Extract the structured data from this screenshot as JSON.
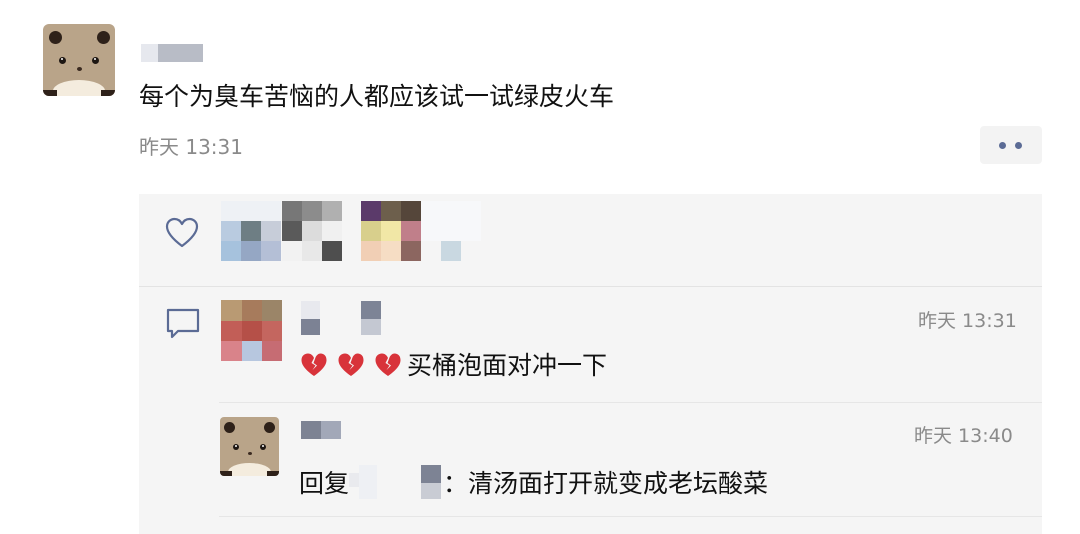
{
  "post": {
    "text": "每个为臭车苦恼的人都应该试一试绿皮火车",
    "time": "昨天 13:31",
    "author_avatar_icon": "bear-avatar-icon",
    "more_icon": "more-dots-icon"
  },
  "likes": {
    "icon": "heart-icon"
  },
  "comments": [
    {
      "icon": "comment-icon",
      "emoji": [
        "broken-heart-emoji",
        "broken-heart-emoji",
        "broken-heart-emoji"
      ],
      "text": "买桶泡面对冲一下",
      "time": "昨天 13:31"
    }
  ],
  "reply": {
    "prefix": "回复",
    "separator": "：",
    "text": "清汤面打开就变成老坛酸菜",
    "time": "昨天 13:40",
    "avatar_icon": "bear-avatar-icon"
  },
  "colors": {
    "background": "#ffffff",
    "panel": "#f5f5f5",
    "timestamp": "#8a8a8a",
    "more_dots": "#5b6b95",
    "icon_stroke": "#5b6b95"
  }
}
